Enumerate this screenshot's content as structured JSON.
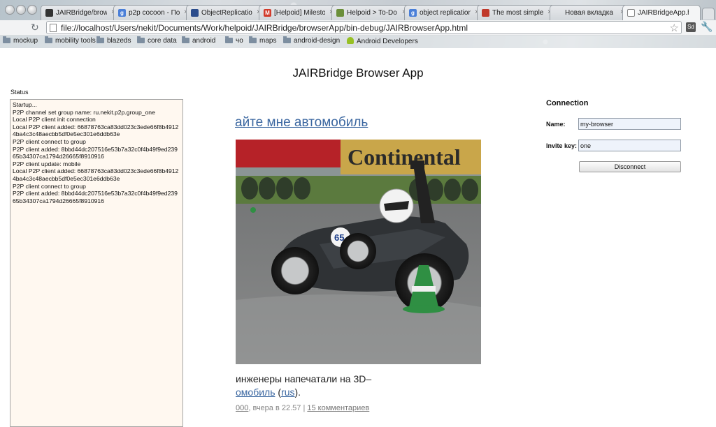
{
  "browser": {
    "tabs": [
      {
        "label": "JAIRBridge/brows",
        "icon": "github-icon",
        "color": "#333333",
        "glyph": "",
        "active": false
      },
      {
        "label": "p2p cocoon - По",
        "icon": "google-icon",
        "color": "#4a7fd8",
        "glyph": "g",
        "active": false
      },
      {
        "label": "ObjectReplication",
        "icon": "site-icon",
        "color": "#2b4c8c",
        "glyph": "",
        "active": false
      },
      {
        "label": "[Helpoid] Milesto",
        "icon": "gmail-icon",
        "color": "#d23b2b",
        "glyph": "M",
        "active": false
      },
      {
        "label": "Helpoid > To-Do",
        "icon": "basecamp-icon",
        "color": "#6b8f3a",
        "glyph": "",
        "active": false
      },
      {
        "label": "object replication",
        "icon": "google-icon",
        "color": "#4a7fd8",
        "glyph": "g",
        "active": false
      },
      {
        "label": "The most simple",
        "icon": "habr-icon",
        "color": "#c0392b",
        "glyph": "",
        "active": false
      },
      {
        "label": "Новая вкладка",
        "icon": "",
        "color": "",
        "glyph": "",
        "active": false
      },
      {
        "label": "JAIRBridgeApp.h",
        "icon": "page-icon",
        "color": "#ffffff",
        "glyph": "",
        "active": true
      }
    ],
    "url": "file://localhost/Users/nekit/Documents/Work/helpoid/JAIRBridge/browserApp/bin-debug/JAIRBrowserApp.html",
    "extension_label": "Sd",
    "bookmarks": [
      {
        "label": "mockup",
        "type": "folder"
      },
      {
        "label": "mobility tools",
        "type": "folder"
      },
      {
        "label": "blazeds",
        "type": "folder"
      },
      {
        "label": "core data",
        "type": "folder"
      },
      {
        "label": "android",
        "type": "folder"
      },
      {
        "label": "чо",
        "type": "folder"
      },
      {
        "label": "maps",
        "type": "folder"
      },
      {
        "label": "android-design",
        "type": "folder"
      },
      {
        "label": "Android Developers",
        "type": "android"
      }
    ]
  },
  "page": {
    "title": "JAIRBridge Browser App",
    "status_label": "Status",
    "status_log": [
      "Startup...",
      "P2P channel set group name: ru.nekit.p2p.group_one",
      "Local P2P client init connection",
      "Local P2P client added: 66878763ca83dd023c3ede66f8b49124ba4c3c48aecbb5df0e5ec301e6ddb63e",
      "P2P client connect to group",
      "P2P client added: 8bbd44dc207516e53b7a32c0f4b49f9ed23965b34307ca1794d26665f8910916",
      "P2P client update: mobile",
      "Local P2P client added: 66878763ca83dd023c3ede66f8b49124ba4c3c48aecbb5df0e5ec301e6ddb63e",
      "P2P client connect to group",
      "P2P client added: 8bbd44dc207516e53b7a32c0f4b49f9ed23965b34307ca1794d26665f8910916"
    ],
    "connection": {
      "title": "Connection",
      "name_label": "Name:",
      "name_value": "my-browser",
      "key_label": "Invite key:",
      "key_value": "one",
      "disconnect_label": "Disconnect"
    },
    "article": {
      "headline": "айте мне автомобиль",
      "photo_banner": "Continental",
      "car_number": "65",
      "text_line1": "инженеры напечатали на 3D–",
      "text_line2_link": "омобиль",
      "text_line2_open": " (",
      "text_line2_lang": "rus",
      "text_line2_close": ").",
      "meta_count": "000",
      "meta_time": ", вчера в 22.57 | ",
      "meta_comments": "15 комментариев"
    }
  }
}
